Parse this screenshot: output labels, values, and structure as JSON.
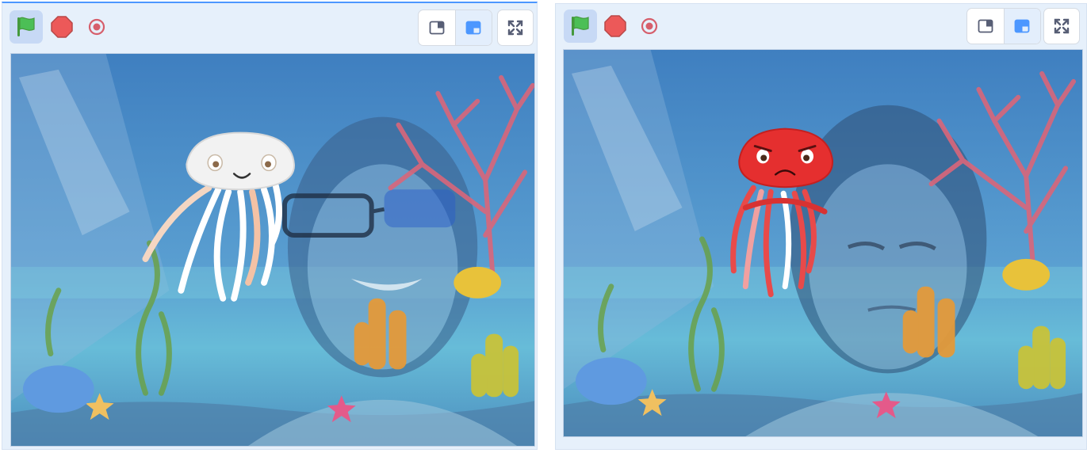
{
  "colors": {
    "accent": "#4c97ff",
    "flag_green": "#4cbf56",
    "stop_red": "#ec5959",
    "record_red": "#d65e6b",
    "panel_bg": "#e6f0fb",
    "water": "#4f8fc6",
    "jellyfish_white": "#f2f2f2",
    "jellyfish_red": "#e52f2f"
  },
  "panels": [
    {
      "id": "left",
      "toolbar": {
        "icons": [
          "green-flag-icon",
          "stop-sign-icon",
          "record-icon",
          "small-stage-icon",
          "large-stage-icon",
          "fullscreen-icon"
        ],
        "selected_layout": "large-stage"
      },
      "stage": {
        "background": "underwater-scene",
        "video_overlay": "webcam-smiling-person",
        "sprite": "jellyfish-happy",
        "sprite_color": "white"
      }
    },
    {
      "id": "right",
      "toolbar": {
        "icons": [
          "green-flag-icon",
          "stop-sign-icon",
          "record-icon",
          "small-stage-icon",
          "large-stage-icon",
          "fullscreen-icon"
        ],
        "selected_layout": "large-stage"
      },
      "stage": {
        "background": "underwater-scene",
        "video_overlay": "webcam-frowning-person",
        "sprite": "jellyfish-angry",
        "sprite_color": "red"
      }
    }
  ]
}
